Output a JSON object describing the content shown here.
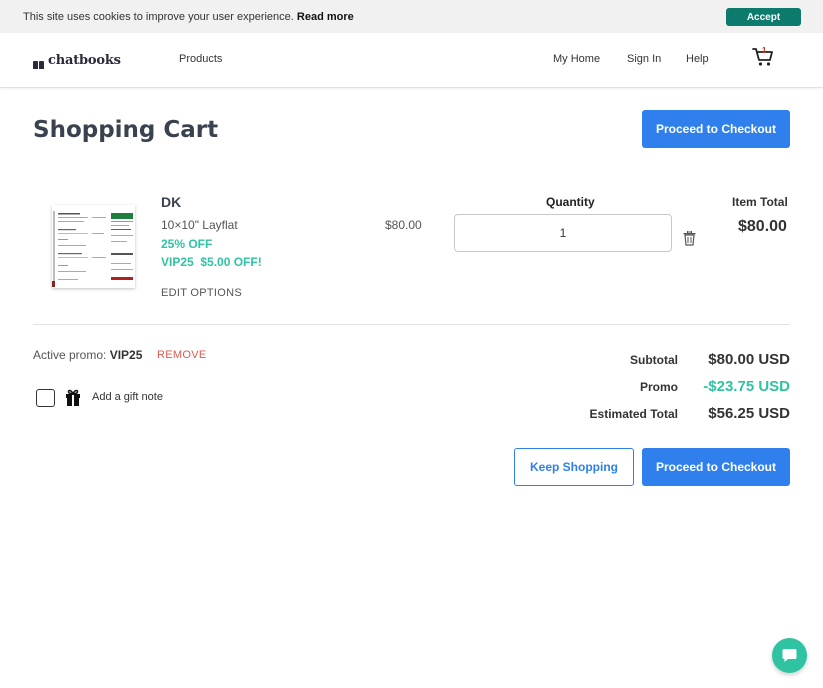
{
  "cookie_bar": {
    "message": "This site uses cookies to improve your user experience.",
    "read_more": "Read more",
    "accept_label": "Accept"
  },
  "header": {
    "logo": "chatbooks",
    "nav_products": "Products",
    "nav_home": "My Home",
    "nav_signin": "Sign In",
    "nav_help": "Help",
    "cart_count": "1"
  },
  "page": {
    "title": "Shopping Cart",
    "checkout_label": "Proceed to Checkout",
    "keep_shopping_label": "Keep Shopping"
  },
  "cart_item": {
    "name": "DK",
    "size": "10×10\" Layflat",
    "discount": "25% OFF",
    "promo": "VIP25  $5.00 OFF!",
    "edit_options": "EDIT OPTIONS",
    "price": "$80.00",
    "quantity_label": "Quantity",
    "quantity": "1",
    "item_total_label": "Item Total",
    "item_total": "$80.00"
  },
  "promo": {
    "label": "Active promo:",
    "code": "VIP25",
    "remove_label": "REMOVE"
  },
  "gift": {
    "label": "Add a gift note",
    "checked": false
  },
  "summary": {
    "subtotal_label": "Subtotal",
    "subtotal_value": "$80.00 USD",
    "promo_label": "Promo",
    "promo_value": "-$23.75 USD",
    "estimated_label": "Estimated Total",
    "estimated_value": "$56.25 USD"
  },
  "colors": {
    "primary": "#2f80ed",
    "accent_green": "#2fc3a2",
    "accept_green": "#0c7a6d",
    "remove_red": "#e05a4f"
  }
}
